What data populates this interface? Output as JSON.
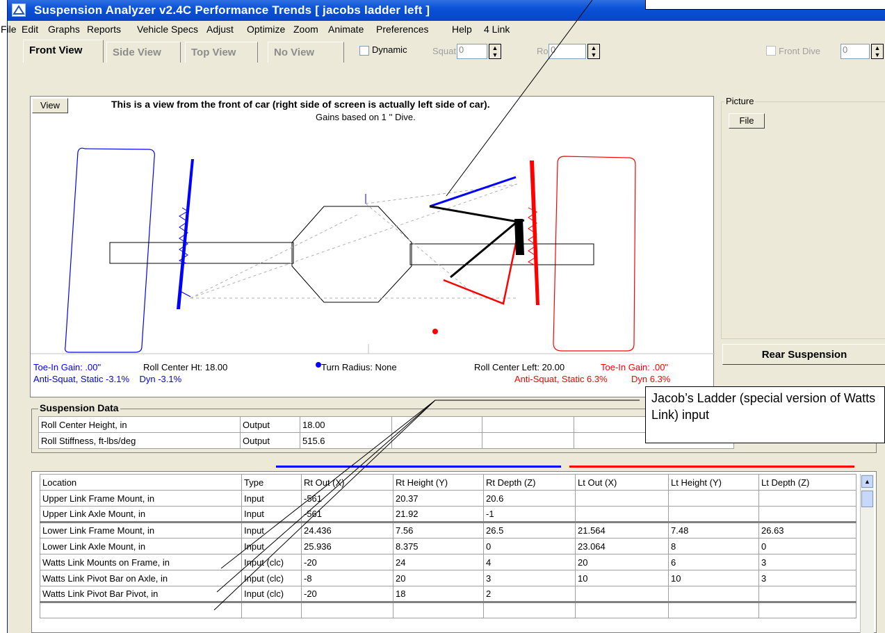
{
  "window": {
    "title": "Suspension Analyzer v2.4C   Performance Trends   [ jacobs ladder left ]"
  },
  "menu": [
    "File",
    "Edit",
    "Graphs",
    "Reports",
    "Vehicle Specs",
    "Adjust",
    "Optimize",
    "Zoom",
    "Animate",
    "Preferences",
    "Help",
    "4 Link"
  ],
  "tabs": [
    "Front View",
    "Side View",
    "Top View",
    "No View"
  ],
  "toolbar": {
    "dynamic_label": "Dynamic",
    "squat_label": "Squat",
    "squat_value": "0",
    "roll_label": "Roll",
    "roll_value": "0",
    "front_dive_label": "Front Dive",
    "front_dive_value": "0"
  },
  "view": {
    "button": "View",
    "caption": "This is a view from the front of car (right side of screen is actually left side of car).",
    "subcaption": "Gains based on 1 '' Dive.",
    "status": {
      "toe_in_right": "Toe-In Gain: .00\"",
      "roll_center_ht": "Roll Center Ht: 18.00",
      "turn_radius": "Turn Radius: None",
      "roll_center_left": "Roll Center Left: 20.00",
      "toe_in_left": "Toe-In Gain: .00\"",
      "anti_squat_right": "Anti-Squat, Static -3.1%    Dyn -3.1%",
      "anti_squat_left": "Anti-Squat, Static 6.3%",
      "dyn_left": "Dyn 6.3%"
    }
  },
  "picture": {
    "label": "Picture",
    "file_button": "File"
  },
  "rear_suspension_button": "Rear Suspension",
  "suspension_data": {
    "label": "Suspension Data",
    "rows": [
      [
        "Roll Center Height, in",
        "Output",
        "18.00"
      ],
      [
        "Roll Stiffness, ft-lbs/deg",
        "Output",
        "515.6"
      ]
    ]
  },
  "location_table": {
    "headers": [
      "Location",
      "Type",
      "Rt Out (X)",
      "Rt Height (Y)",
      "Rt Depth (Z)",
      "Lt Out (X)",
      "Lt Height (Y)",
      "Lt Depth (Z)"
    ],
    "rows": [
      [
        "Upper Link Frame Mount, in",
        "Input",
        "-561",
        "20.37",
        "20.6",
        "",
        "",
        ""
      ],
      [
        "Upper Link Axle Mount, in",
        "Input",
        "-561",
        "21.92",
        "-1",
        "",
        "",
        ""
      ],
      [
        "Lower Link Frame Mount, in",
        "Input",
        "24.436",
        "7.56",
        "26.5",
        "21.564",
        "7.48",
        "26.63"
      ],
      [
        "Lower Link Axle Mount, in",
        "Input",
        "25.936",
        "8.375",
        "0",
        "23.064",
        "8",
        "0"
      ],
      [
        "Watts Link Mounts on Frame, in",
        "Input (clc)",
        "-20",
        "24",
        "4",
        "20",
        "6",
        "3"
      ],
      [
        "Watts Link Pivot Bar on Axle, in",
        "Input (clc)",
        "-8",
        "20",
        "3",
        "10",
        "10",
        "3"
      ],
      [
        "Watts Link Pivot Bar Pivot, in",
        "Input (clc)",
        "-20",
        "18",
        "2",
        "",
        "",
        ""
      ],
      [
        "",
        "",
        "",
        "",
        "",
        "",
        "",
        ""
      ]
    ]
  },
  "callout": {
    "text": "Jacob’s Ladder (special version of Watts Link) input"
  },
  "colors": {
    "right_side": "#0000ff",
    "left_side": "#ff0000"
  }
}
